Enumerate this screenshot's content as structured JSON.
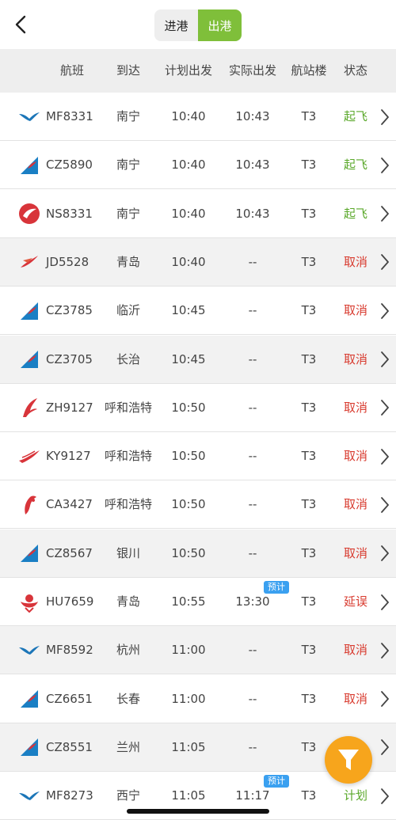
{
  "tabs": {
    "arrivals": "进港",
    "departures": "出港"
  },
  "header": {
    "flight": "航班",
    "dest": "到达",
    "plan": "计划出发",
    "actual": "实际出发",
    "terminal": "航站楼",
    "status": "状态"
  },
  "colors": {
    "accent": "#7fbf3a",
    "departed": "#5aa82a",
    "cancelled": "#d83a2e",
    "fab": "#f7a51c",
    "tag": "#3aa0f0"
  },
  "rows": [
    {
      "airline": "xiamen",
      "flight": "MF8331",
      "dest": "南宁",
      "plan": "10:40",
      "actual": "10:43",
      "terminal": "T3",
      "status": "起飞",
      "tag": ""
    },
    {
      "airline": "china-southern",
      "flight": "CZ5890",
      "dest": "南宁",
      "plan": "10:40",
      "actual": "10:43",
      "terminal": "T3",
      "status": "起飞",
      "tag": ""
    },
    {
      "airline": "hebei",
      "flight": "NS8331",
      "dest": "南宁",
      "plan": "10:40",
      "actual": "10:43",
      "terminal": "T3",
      "status": "起飞",
      "tag": ""
    },
    {
      "airline": "juneyao",
      "flight": "JD5528",
      "dest": "青岛",
      "plan": "10:40",
      "actual": "--",
      "terminal": "T3",
      "status": "取消",
      "tag": ""
    },
    {
      "airline": "china-southern",
      "flight": "CZ3785",
      "dest": "临沂",
      "plan": "10:45",
      "actual": "--",
      "terminal": "T3",
      "status": "取消",
      "tag": ""
    },
    {
      "airline": "china-southern",
      "flight": "CZ3705",
      "dest": "长治",
      "plan": "10:45",
      "actual": "--",
      "terminal": "T3",
      "status": "取消",
      "tag": ""
    },
    {
      "airline": "shenzhen",
      "flight": "ZH9127",
      "dest": "呼和浩特",
      "plan": "10:50",
      "actual": "--",
      "terminal": "T3",
      "status": "取消",
      "tag": ""
    },
    {
      "airline": "kunming",
      "flight": "KY9127",
      "dest": "呼和浩特",
      "plan": "10:50",
      "actual": "--",
      "terminal": "T3",
      "status": "取消",
      "tag": ""
    },
    {
      "airline": "air-china",
      "flight": "CA3427",
      "dest": "呼和浩特",
      "plan": "10:50",
      "actual": "--",
      "terminal": "T3",
      "status": "取消",
      "tag": ""
    },
    {
      "airline": "china-southern",
      "flight": "CZ8567",
      "dest": "银川",
      "plan": "10:50",
      "actual": "--",
      "terminal": "T3",
      "status": "取消",
      "tag": ""
    },
    {
      "airline": "hainan",
      "flight": "HU7659",
      "dest": "青岛",
      "plan": "10:55",
      "actual": "13:30",
      "terminal": "T3",
      "status": "延误",
      "tag": "预计"
    },
    {
      "airline": "xiamen",
      "flight": "MF8592",
      "dest": "杭州",
      "plan": "11:00",
      "actual": "--",
      "terminal": "T3",
      "status": "取消",
      "tag": ""
    },
    {
      "airline": "china-southern",
      "flight": "CZ6651",
      "dest": "长春",
      "plan": "11:00",
      "actual": "--",
      "terminal": "T3",
      "status": "取消",
      "tag": ""
    },
    {
      "airline": "china-southern",
      "flight": "CZ8551",
      "dest": "兰州",
      "plan": "11:05",
      "actual": "--",
      "terminal": "T3",
      "status": "",
      "tag": ""
    },
    {
      "airline": "xiamen",
      "flight": "MF8273",
      "dest": "西宁",
      "plan": "11:05",
      "actual": "11:17",
      "terminal": "T3",
      "status": "计划",
      "tag": "预计"
    }
  ]
}
